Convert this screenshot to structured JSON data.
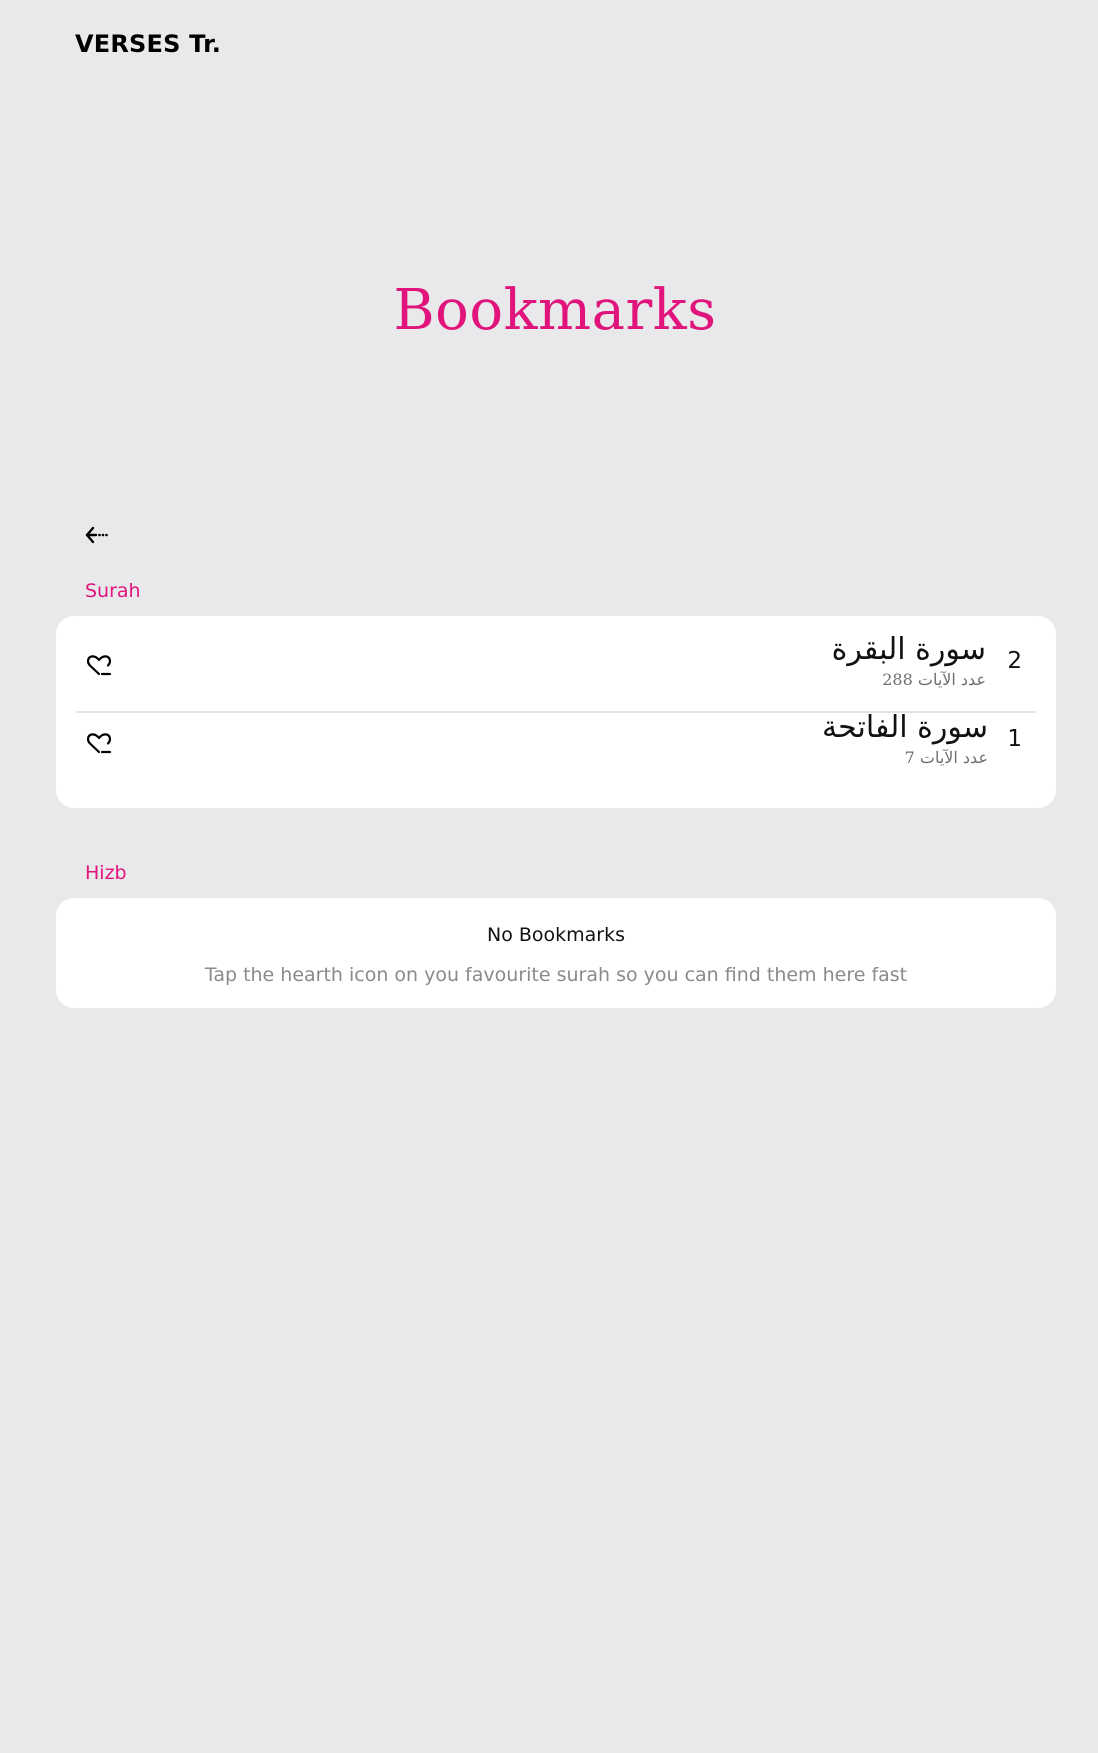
{
  "app": {
    "brand": "VERSES Tr."
  },
  "header": {
    "title": "Bookmarks"
  },
  "colors": {
    "accent": "#e0147c",
    "background": "#e9e9eb",
    "card": "#ffffff"
  },
  "nav": {
    "back_icon": "arrow-left-icon"
  },
  "sections": {
    "surah": {
      "label": "Surah",
      "items": [
        {
          "number": "2",
          "name": "سورة البقرة",
          "ayahs": "عدد الآيات 288",
          "icon": "heart-icon"
        },
        {
          "number": "1",
          "name": "سورة الفاتحة",
          "ayahs": "عدد الآيات 7",
          "icon": "heart-icon"
        }
      ]
    },
    "hizb": {
      "label": "Hizb",
      "empty_title": "No Bookmarks",
      "empty_subtitle": "Tap the hearth icon on you favourite surah so you can find them here fast"
    }
  }
}
